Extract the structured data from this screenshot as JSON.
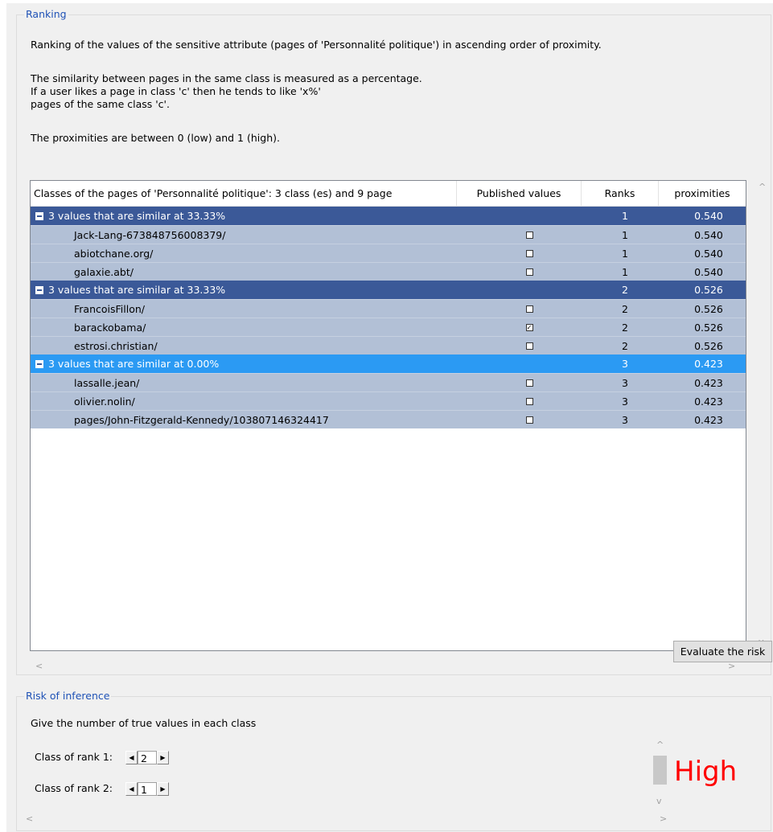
{
  "ranking": {
    "group_title": "Ranking",
    "description_lines": [
      "Ranking of the values of the sensitive attribute (pages of 'Personnalité politique') in ascending order of proximity.",
      "The similarity between pages in the same class is measured as a percentage.",
      "If a user likes a page in class 'c' then he tends to like 'x%'",
      "pages of the same class 'c'.",
      "The proximities are between 0 (low) and 1 (high)."
    ],
    "table": {
      "headers": {
        "name": "Classes of the pages of 'Personnalité politique': 3 class (es) and 9 page",
        "published": "Published values",
        "ranks": "Ranks",
        "proximities": "proximities"
      },
      "groups": [
        {
          "label": "3 values that are similar at 33.33%",
          "rank": "1",
          "proximity": "0.540",
          "selected": false,
          "children": [
            {
              "name": "Jack-Lang-673848756008379/",
              "published": false,
              "rank": "1",
              "proximity": "0.540"
            },
            {
              "name": "abiotchane.org/",
              "published": false,
              "rank": "1",
              "proximity": "0.540"
            },
            {
              "name": "galaxie.abt/",
              "published": false,
              "rank": "1",
              "proximity": "0.540"
            }
          ]
        },
        {
          "label": "3 values that are similar at 33.33%",
          "rank": "2",
          "proximity": "0.526",
          "selected": false,
          "children": [
            {
              "name": "FrancoisFillon/",
              "published": false,
              "rank": "2",
              "proximity": "0.526"
            },
            {
              "name": "barackobama/",
              "published": true,
              "rank": "2",
              "proximity": "0.526"
            },
            {
              "name": "estrosi.christian/",
              "published": false,
              "rank": "2",
              "proximity": "0.526"
            }
          ]
        },
        {
          "label": "3 values that are similar at 0.00%",
          "rank": "3",
          "proximity": "0.423",
          "selected": true,
          "children": [
            {
              "name": "lassalle.jean/",
              "published": false,
              "rank": "3",
              "proximity": "0.423"
            },
            {
              "name": "olivier.nolin/",
              "published": false,
              "rank": "3",
              "proximity": "0.423"
            },
            {
              "name": "pages/John-Fitzgerald-Kennedy/103807146324417",
              "published": false,
              "rank": "3",
              "proximity": "0.423"
            }
          ]
        }
      ]
    }
  },
  "risk": {
    "group_title": "Risk of inference",
    "instruction": "Give the number of true values in each class",
    "evaluate_button": "Evaluate the risk",
    "spinners": [
      {
        "label": "Class of rank 1:",
        "value": "2"
      },
      {
        "label": "Class of rank 2:",
        "value": "1"
      }
    ],
    "level": "High",
    "level_color": "#ff0000"
  },
  "icons": {
    "left_arrow": "◀",
    "right_arrow": "▶",
    "checkbox_checked": "☑",
    "scroll_up": "^",
    "scroll_down": "v",
    "scroll_left": "<",
    "scroll_right": ">"
  }
}
